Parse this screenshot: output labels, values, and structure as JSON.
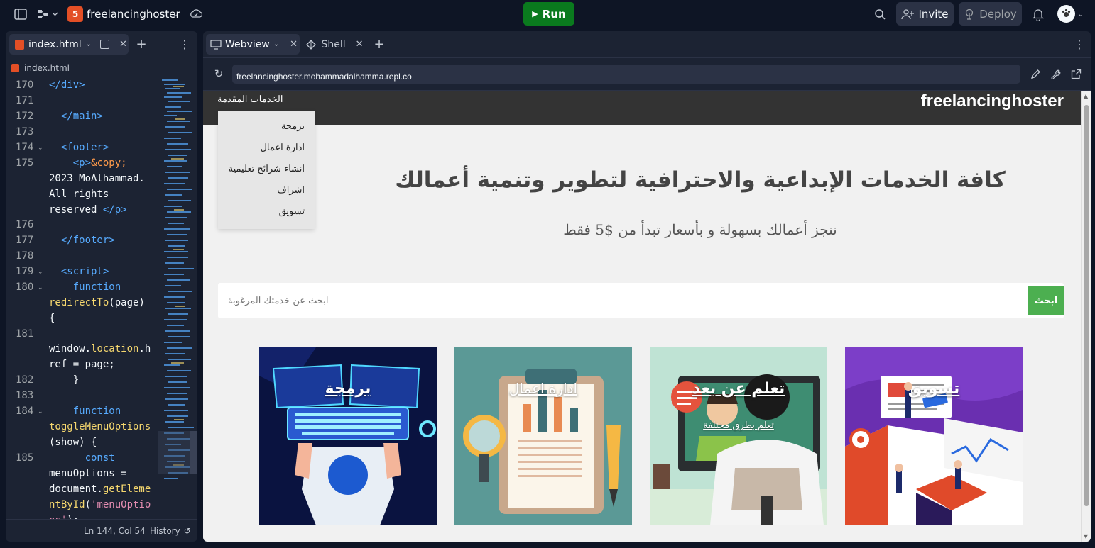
{
  "topbar": {
    "project_name": "freelancinghoster",
    "run_label": "Run",
    "invite_label": "Invite",
    "deploy_label": "Deploy"
  },
  "editor": {
    "tab_label": "index.html",
    "breadcrumb": "index.html",
    "status": "Ln 144, Col 54",
    "history_label": "History"
  },
  "webview_panel": {
    "tab_webview": "Webview",
    "tab_shell": "Shell",
    "url": "freelancinghoster.mohammadalhamma.repl.co"
  },
  "site": {
    "brand": "freelancinghoster",
    "menu_label": "الخدمات المقدمة",
    "menu_items": [
      "برمجة",
      "ادارة اعمال",
      "انشاء شرائح تعليمية",
      "اشراف",
      "تسويق"
    ],
    "headline": "كافة الخدمات الإبداعية والاحترافية لتطوير وتنمية أعمالك",
    "subheadline": "ننجز أعمالك بسهولة و بأسعار تبدأ من $5 فقط",
    "search_placeholder": "ابحث عن خدمتك المرغوبة",
    "search_button": "ابحث",
    "cards": [
      {
        "title": "برمجة",
        "subtitle": ""
      },
      {
        "title": "ادارة اعمال",
        "subtitle": ""
      },
      {
        "title": "تعلم عن بعد",
        "subtitle": "تعلم بطرق مختلفة"
      },
      {
        "title": "تسويق",
        "subtitle": ""
      }
    ]
  },
  "colors": {
    "run_green": "#0a7a1e",
    "ide_bg": "#0e1525",
    "panel_bg": "#1c2333",
    "site_header": "#333333",
    "search_btn": "#4caf50"
  }
}
